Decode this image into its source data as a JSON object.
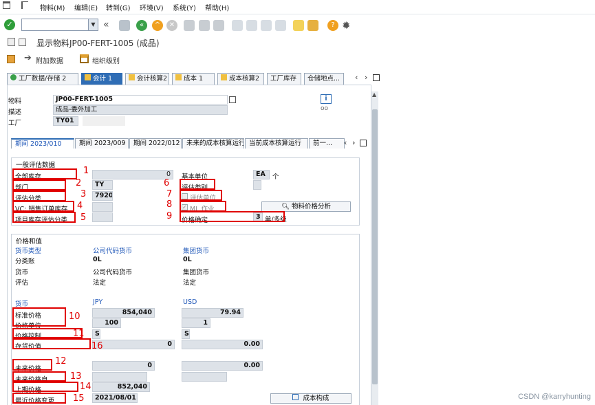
{
  "menu": [
    "物料(M)",
    "编辑(E)",
    "转到(G)",
    "环境(V)",
    "系统(Y)",
    "帮助(H)"
  ],
  "title": "显示物料JP00-FERT-1005 (成品)",
  "app_toolbar": {
    "additional_data": "附加数据",
    "org_levels": "组织级别"
  },
  "tabs": [
    "工厂数据/存储 2",
    "会计 1",
    "会计核算2",
    "成本 1",
    "成本核算2",
    "工厂库存",
    "仓储地点..."
  ],
  "header": {
    "material_label": "物料",
    "material_value": "JP00-FERT-1005",
    "desc_label": "描述",
    "desc_value": "成品-委外加工",
    "plant_label": "工厂",
    "plant_value": "TY01"
  },
  "subtabs": [
    "期间 2023/010",
    "期间 2023/009",
    "期间 2022/012",
    "未来的成本核算运行",
    "当前成本核算运行",
    "前一..."
  ],
  "general": {
    "title": "一般评估数据",
    "total_stock": "全部库存",
    "total_stock_val": "0",
    "division": "部门",
    "division_val": "TY",
    "val_class": "评估分类",
    "val_class_val": "7920",
    "vc_sales": "VC: 销售订单库存",
    "proj_class": "项目库存评估分类",
    "base_unit": "基本单位",
    "base_unit_val": "EA",
    "base_unit_text": "个",
    "val_category": "评估类别",
    "val_unit": "评估单位",
    "ml_act": "ML 作业",
    "price_det": "价格确定",
    "price_det_val": "3",
    "price_det_text": "单/多级",
    "analysis_btn": "物料价格分析"
  },
  "prices": {
    "title": "价格和值",
    "currency_type": "货币类型",
    "company_code": "公司代码货币",
    "group_cur": "集团货币",
    "ledger": "分类账",
    "ledger_v1": "0L",
    "ledger_v2": "0L",
    "currency": "货币",
    "cur_v1": "公司代码货币",
    "cur_v2": "集团货币",
    "valuation": "评估",
    "val_v1": "法定",
    "val_v2": "法定",
    "cur_label": "货币",
    "cur_code1": "JPY",
    "cur_code2": "USD",
    "std_price": "标准价格",
    "std_price_v1": "854,040",
    "std_price_v2": "79.94",
    "price_unit": "价格单位",
    "price_unit_v1": "100",
    "price_unit_v2": "1",
    "price_ctrl": "价格控制",
    "price_ctrl_v1": "S",
    "price_ctrl_v2": "S",
    "inv_value": "存货价值",
    "inv_value_v1": "0",
    "inv_value_v2": "0.00",
    "future_price": "未来价格",
    "future_v1": "0",
    "future_v2": "0.00",
    "future_from": "未来价格自",
    "prev_price": "上期价格",
    "prev_v1": "852,040",
    "last_change": "最近价格变更",
    "last_change_v1": "2021/08/01",
    "cost_btn": "成本构成"
  },
  "markers": [
    "1",
    "2",
    "3",
    "4",
    "5",
    "6",
    "7",
    "8",
    "9",
    "10",
    "11",
    "12",
    "13",
    "14",
    "15",
    "16"
  ],
  "watermark": "CSDN @karryhunting"
}
